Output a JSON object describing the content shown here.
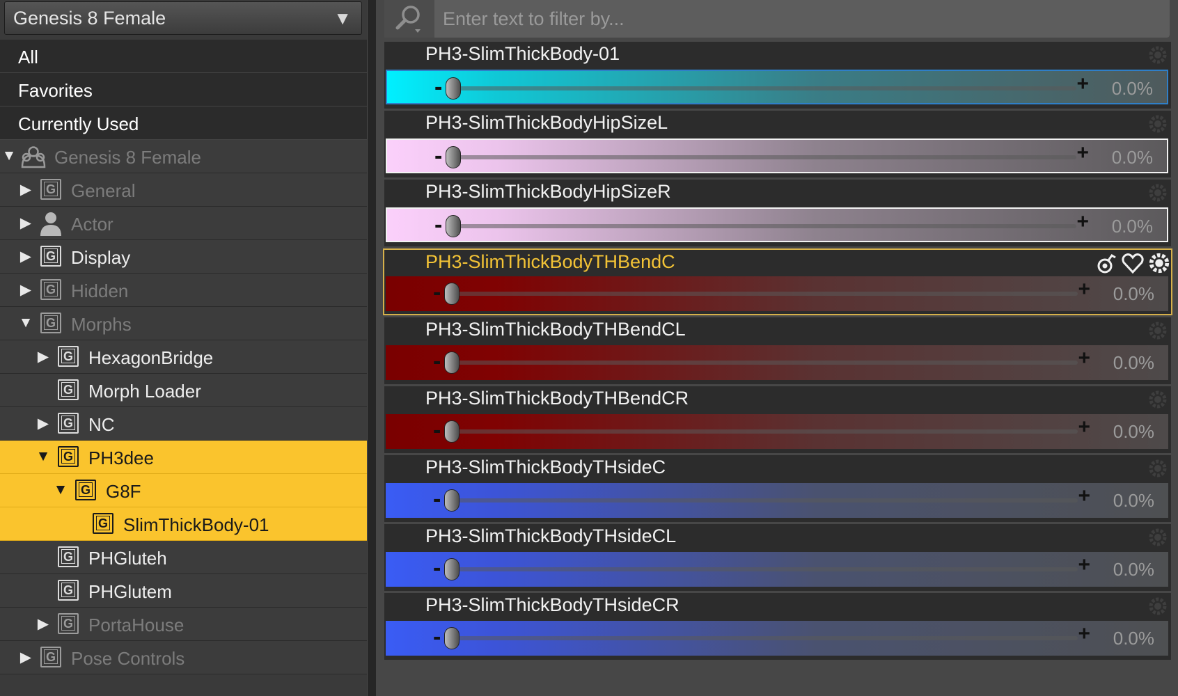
{
  "figure_selector": {
    "value": "Genesis 8 Female"
  },
  "tree": {
    "top_items": [
      "All",
      "Favorites",
      "Currently Used"
    ],
    "root": "Genesis 8 Female",
    "nodes": [
      {
        "label": "General"
      },
      {
        "label": "Actor"
      },
      {
        "label": "Display"
      },
      {
        "label": "Hidden"
      },
      {
        "label": "Morphs"
      },
      {
        "label": "HexagonBridge"
      },
      {
        "label": "Morph Loader"
      },
      {
        "label": "NC"
      },
      {
        "label": "PH3dee"
      },
      {
        "label": "G8F"
      },
      {
        "label": "SlimThickBody-01"
      },
      {
        "label": "PHGluteh"
      },
      {
        "label": "PHGlutem"
      },
      {
        "label": "PortaHouse"
      },
      {
        "label": "Pose Controls"
      }
    ]
  },
  "filter": {
    "placeholder": "Enter text to filter by..."
  },
  "properties": [
    {
      "name": "PH3-SlimThickBody-01",
      "value": "0.0%",
      "color": "#00e8f0"
    },
    {
      "name": "PH3-SlimThickBodyHipSizeL",
      "value": "0.0%",
      "color": "#f6c6f6"
    },
    {
      "name": "PH3-SlimThickBodyHipSizeR",
      "value": "0.0%",
      "color": "#f6c6f6"
    },
    {
      "name": "PH3-SlimThickBodyTHBendC",
      "value": "0.0%",
      "color": "#8a0000"
    },
    {
      "name": "PH3-SlimThickBodyTHBendCL",
      "value": "0.0%",
      "color": "#8a0000"
    },
    {
      "name": "PH3-SlimThickBodyTHBendCR",
      "value": "0.0%",
      "color": "#8a0000"
    },
    {
      "name": "PH3-SlimThickBodyTHsideC",
      "value": "0.0%",
      "color": "#3b5cf0"
    },
    {
      "name": "PH3-SlimThickBodyTHsideCL",
      "value": "0.0%",
      "color": "#3b5cf0"
    },
    {
      "name": "PH3-SlimThickBodyTHsideCR",
      "value": "0.0%",
      "color": "#3b5cf0"
    }
  ],
  "slider_labels": {
    "minus": "-",
    "plus": "+"
  },
  "icons": {
    "search": "search-icon",
    "gear": "gear-icon",
    "link": "link-icon",
    "favorite": "heart-icon"
  },
  "theme": {
    "selection": "#fac42d",
    "active_border": "#d6b04a"
  }
}
